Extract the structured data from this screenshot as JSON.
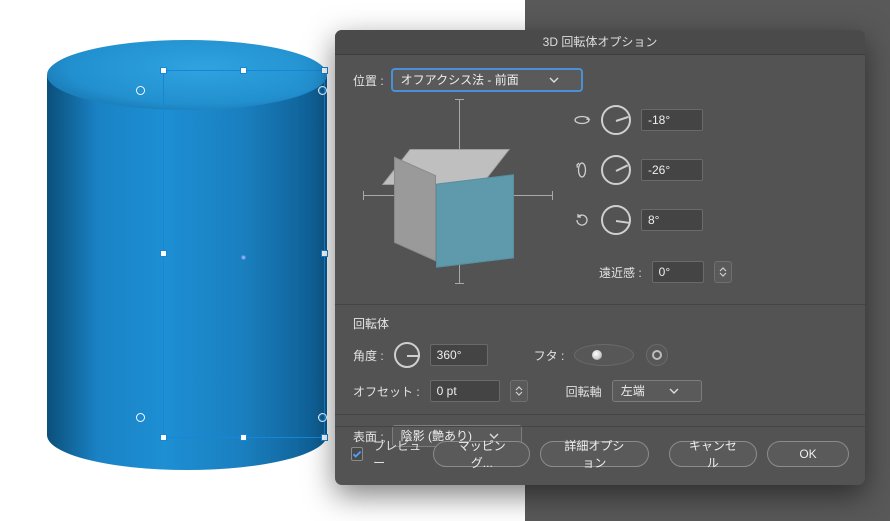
{
  "dialog": {
    "title": "3D 回転体オプション",
    "position_label": "位置 :",
    "position_value": "オフアクシス法 - 前面",
    "angles": {
      "x": "-18°",
      "y": "-26°",
      "z": "8°"
    },
    "perspective_label": "遠近感 :",
    "perspective_value": "0°",
    "revolve": {
      "section_title": "回転体",
      "angle_label": "角度 :",
      "angle_value": "360°",
      "cap_label": "フタ :",
      "offset_label": "オフセット :",
      "offset_value": "0 pt",
      "axis_label": "回転軸",
      "axis_value": "左端"
    },
    "surface_label": "表面 :",
    "surface_value": "陰影 (艶あり)",
    "footer": {
      "preview": "プレビュー",
      "map_art": "マッピング...",
      "more_options": "詳細オプション",
      "cancel": "キャンセル",
      "ok": "OK"
    }
  },
  "icons": {
    "rot_x": "rotate-horizontal-icon",
    "rot_y": "rotate-vertical-icon",
    "rot_z": "rotate-clockwise-icon"
  }
}
